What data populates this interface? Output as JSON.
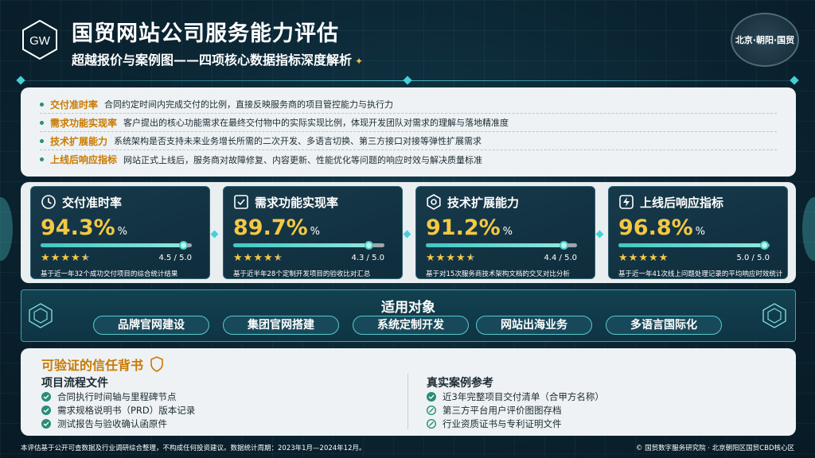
{
  "header": {
    "logo_text": "GW",
    "title": "国贸网站公司服务能力评估",
    "subtitle": "超越报价与案例图——四项核心数据指标深度解析",
    "subtitle_mark": "✦",
    "badge": "北京·朝阳·国贸"
  },
  "definitions": [
    {
      "name": "交付准时率",
      "desc": "合同约定时间内完成交付的比例，直接反映服务商的项目管控能力与执行力"
    },
    {
      "name": "需求功能实现率",
      "desc": "客户提出的核心功能需求在最终交付物中的实际实现比例，体现开发团队对需求的理解与落地精准度"
    },
    {
      "name": "技术扩展能力",
      "desc": "系统架构是否支持未来业务增长所需的二次开发、多语言切换、第三方接口对接等弹性扩展需求"
    },
    {
      "name": "上线后响应指标",
      "desc": "网站正式上线后，服务商对故障修复、内容更新、性能优化等问题的响应时效与解决质量标准"
    }
  ],
  "metrics": [
    {
      "title": "交付准时率",
      "value": "94.3%",
      "unit": "%",
      "rating": "4.5 / 5.0",
      "stars": 4.5,
      "progress": 0.943,
      "note": "基于近一年32个成功交付项目的综合统计结果",
      "icon": "clock-icon"
    },
    {
      "title": "需求功能实现率",
      "value": "89.7%",
      "unit": "%",
      "rating": "4.3 / 5.0",
      "stars": 4.3,
      "progress": 0.897,
      "note": "基于近半年28个定制开发项目的验收比对汇总",
      "icon": "checkbox-icon"
    },
    {
      "title": "技术扩展能力",
      "value": "91.2%",
      "unit": "%",
      "rating": "4.4 / 5.0",
      "stars": 4.4,
      "progress": 0.912,
      "note": "基于对15次服务商技术架构文档的交叉对比分析",
      "icon": "gear-icon"
    },
    {
      "title": "上线后响应指标",
      "value": "96.8%",
      "unit": "%",
      "rating": "5.0 / 5.0",
      "stars": 5.0,
      "progress": 0.968,
      "note": "基于近一年41次线上问题处理记录的平均响应时效统计",
      "icon": "lightning-icon"
    }
  ],
  "applicable": {
    "title": "适用对象",
    "tags": [
      "品牌官网建设",
      "集团官网搭建",
      "系统定制开发",
      "网站出海业务",
      "多语言国际化"
    ]
  },
  "trust": {
    "title": "可验证的信任背书",
    "left": {
      "title": "项目流程文件",
      "items": [
        "合同执行时间轴与里程碑节点",
        "需求规格说明书（PRD）版本记录",
        "测试报告与验收确认函原件"
      ]
    },
    "right": {
      "title": "真实案例参考",
      "items": [
        "近3年完整项目交付清单（合甲方名称）",
        "第三方平台用户评价图图存档",
        "行业资质证书与专利证明文件"
      ]
    }
  },
  "footer": {
    "left": "本评估基于公开可查数据及行业调研综合整理，不构成任何投资建议。数据统计周期：2023年1月—2024年12月。",
    "right": "© 国贸数字服务研究院 · 北京朝阳区国贸CBD核心区"
  },
  "colors": {
    "accent": "#f5c842",
    "teal": "#43d0d6",
    "orange": "#c97a00"
  }
}
